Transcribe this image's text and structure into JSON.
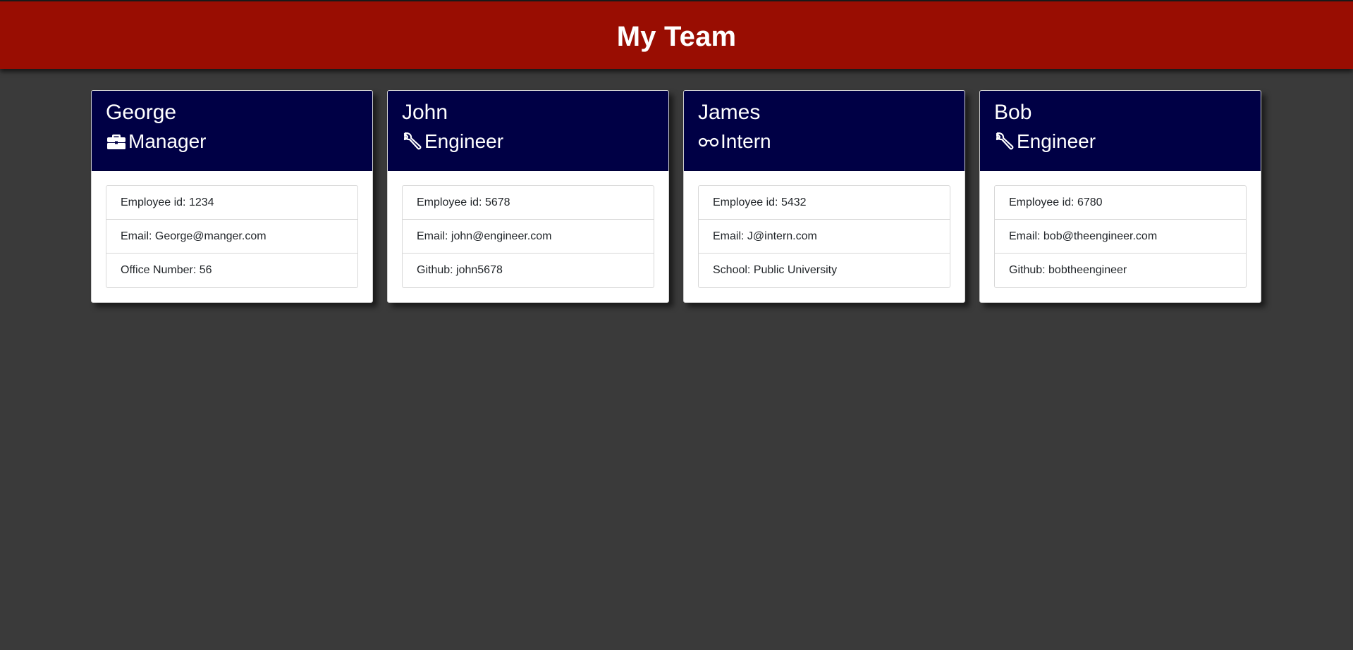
{
  "header": {
    "title": "My Team"
  },
  "team": [
    {
      "name": "George",
      "role": "Manager",
      "icon": "briefcase-icon",
      "details": [
        "Employee id: 1234",
        "Email: George@manger.com",
        "Office Number: 56"
      ]
    },
    {
      "name": "John",
      "role": "Engineer",
      "icon": "wrench-icon",
      "details": [
        "Employee id: 5678",
        "Email: john@engineer.com",
        "Github: john5678"
      ]
    },
    {
      "name": "James",
      "role": "Intern",
      "icon": "glasses-icon",
      "details": [
        "Employee id: 5432",
        "Email: J@intern.com",
        "School: Public University"
      ]
    },
    {
      "name": "Bob",
      "role": "Engineer",
      "icon": "wrench-icon",
      "details": [
        "Employee id: 6780",
        "Email: bob@theengineer.com",
        "Github: bobtheengineer"
      ]
    }
  ],
  "colors": {
    "header_bg": "#990d02",
    "card_header_bg": "#000045",
    "page_bg": "#3a3a3a"
  }
}
